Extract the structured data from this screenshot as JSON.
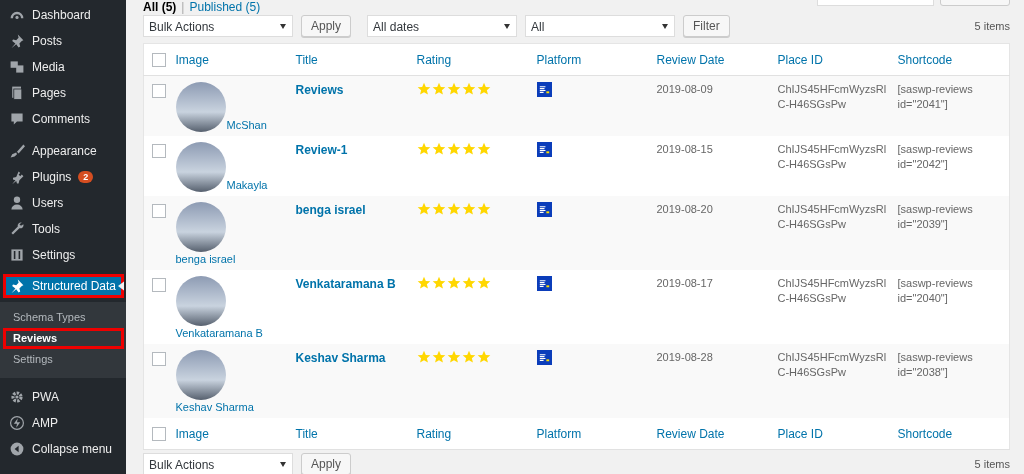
{
  "sidebar": {
    "items": [
      {
        "label": "Dashboard",
        "selected": false
      },
      {
        "label": "Posts",
        "selected": false
      },
      {
        "label": "Media",
        "selected": false
      },
      {
        "label": "Pages",
        "selected": false
      },
      {
        "label": "Comments",
        "selected": false
      },
      {
        "label": "Appearance",
        "selected": false
      },
      {
        "label": "Plugins",
        "selected": false,
        "badge": "2"
      },
      {
        "label": "Users",
        "selected": false
      },
      {
        "label": "Tools",
        "selected": false
      },
      {
        "label": "Settings",
        "selected": false
      },
      {
        "label": "Structured Data",
        "selected": true,
        "children": [
          {
            "label": "Schema Types",
            "selected": false
          },
          {
            "label": "Reviews",
            "selected": true
          },
          {
            "label": "Settings",
            "selected": false
          }
        ]
      },
      {
        "label": "PWA",
        "selected": false
      },
      {
        "label": "AMP",
        "selected": false
      },
      {
        "label": "Collapse menu",
        "selected": false
      }
    ]
  },
  "views": [
    {
      "label": "All (5)",
      "selected": true
    },
    {
      "label": "Published (5)",
      "selected": false
    }
  ],
  "view_separator": "|",
  "toolbar": {
    "bulk_action": "Bulk Actions",
    "apply": "Apply",
    "dates": "All dates",
    "platform": "All",
    "filter": "Filter",
    "count": "5 items"
  },
  "table": {
    "columns": [
      "Image",
      "Title",
      "Rating",
      "Platform",
      "Review Date",
      "Place ID",
      "Shortcode"
    ],
    "header_checked": false,
    "footer_columns": [
      "Image",
      "Title",
      "Rating",
      "Platform",
      "Review Date",
      "Place ID",
      "Shortcode"
    ],
    "footer_checked": false,
    "rows": [
      {
        "checked": false,
        "author": "McShan",
        "title": "Reviews",
        "stars": 5,
        "date": "2019-08-09",
        "place_id": "ChIJS45HFcmWyzsRlC-H46SGsPw",
        "shortcode": "[saswp-reviews id=\"2041\"]"
      },
      {
        "checked": false,
        "author": "Makayla",
        "title": "Review-1",
        "stars": 5,
        "date": "2019-08-15",
        "place_id": "ChIJS45HFcmWyzsRlC-H46SGsPw",
        "shortcode": "[saswp-reviews id=\"2042\"]"
      },
      {
        "checked": false,
        "author": "benga israel",
        "title": "benga israel",
        "stars": 5,
        "date": "2019-08-20",
        "place_id": "ChIJS45HFcmWyzsRlC-H46SGsPw",
        "shortcode": "[saswp-reviews id=\"2039\"]"
      },
      {
        "checked": false,
        "author": "Venkataramana B",
        "title": "Venkataramana B",
        "stars": 5,
        "date": "2019-08-17",
        "place_id": "ChIJS45HFcmWyzsRlC-H46SGsPw",
        "shortcode": "[saswp-reviews id=\"2040\"]"
      },
      {
        "checked": false,
        "author": "Keshav Sharma",
        "title": "Keshav Sharma",
        "stars": 5,
        "date": "2019-08-28",
        "place_id": "ChIJS45HFcmWyzsRlC-H46SGsPw",
        "shortcode": "[saswp-reviews id=\"2038\"]"
      }
    ]
  },
  "bottom_toolbar": {
    "bulk_action": "Bulk Actions",
    "apply": "Apply",
    "count": "5 items"
  }
}
